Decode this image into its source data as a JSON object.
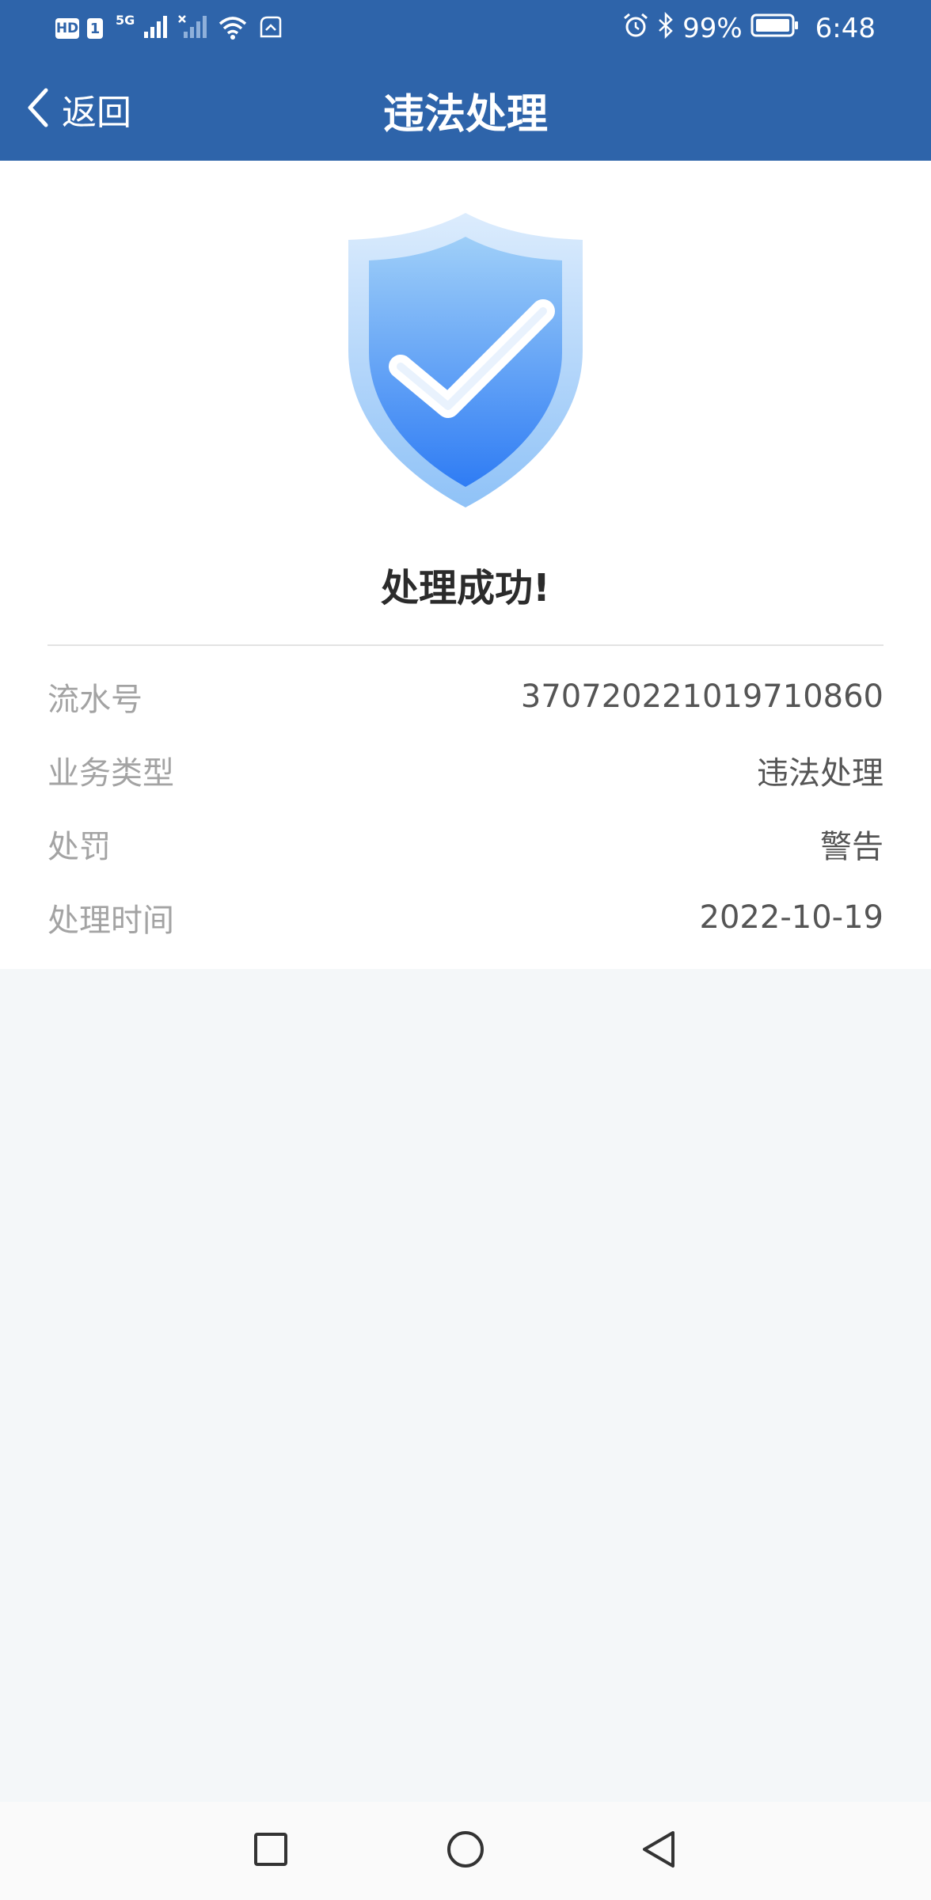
{
  "status_bar": {
    "hd_badge": "HD",
    "sim_badge": "1",
    "network": "5G",
    "battery_percent": "99%",
    "time": "6:48"
  },
  "nav": {
    "back_label": "返回",
    "title": "违法处理"
  },
  "result": {
    "message": "处理成功!"
  },
  "details": [
    {
      "label": "流水号",
      "value": "370720221019710860"
    },
    {
      "label": "业务类型",
      "value": "违法处理"
    },
    {
      "label": "处罚",
      "value": "警告"
    },
    {
      "label": "处理时间",
      "value": "2022-10-19"
    }
  ],
  "colors": {
    "header_bg": "#2e64aa",
    "shield_blue": "#3b86f5",
    "page_bg": "#f4f7f9"
  },
  "icons": {
    "back": "chevron-left-icon",
    "shield": "shield-check-icon",
    "recents": "square-icon",
    "home": "circle-icon",
    "back_nav": "triangle-back-icon"
  }
}
